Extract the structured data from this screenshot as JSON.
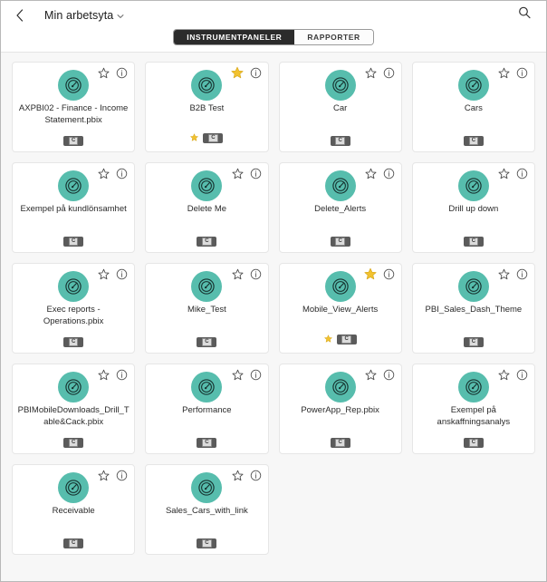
{
  "header": {
    "back_icon": "chevron-left-icon",
    "workspace_title": "Min arbetsyta",
    "dropdown_icon": "chevron-down-icon",
    "search_icon": "search-icon"
  },
  "tabs": [
    {
      "label": "INSTRUMENTPANELER",
      "active": true
    },
    {
      "label": "RAPPORTER",
      "active": false
    }
  ],
  "colors": {
    "accent_teal": "#57bdad",
    "star_gold": "#f2c230",
    "badge_dark": "#5b5b5b",
    "active_tab_bg": "#2b2b2b",
    "content_bg": "#f7f7f7"
  },
  "cards": [
    {
      "title": "AXPBI02 - Finance - Income Statement.pbix",
      "icon": "dashboard-gauge-icon",
      "favorite": false,
      "badge": "C"
    },
    {
      "title": "B2B Test",
      "icon": "dashboard-gauge-icon",
      "favorite": true,
      "badge": "C"
    },
    {
      "title": "Car",
      "icon": "dashboard-gauge-icon",
      "favorite": false,
      "badge": "C"
    },
    {
      "title": "Cars",
      "icon": "dashboard-gauge-icon",
      "favorite": false,
      "badge": "C"
    },
    {
      "title": "Exempel på kundlönsamhet",
      "icon": "dashboard-gauge-icon",
      "favorite": false,
      "badge": "C"
    },
    {
      "title": "Delete Me",
      "icon": "dashboard-gauge-icon",
      "favorite": false,
      "badge": "C"
    },
    {
      "title": "Delete_Alerts",
      "icon": "dashboard-gauge-icon",
      "favorite": false,
      "badge": "C"
    },
    {
      "title": "Drill up down",
      "icon": "dashboard-gauge-icon",
      "favorite": false,
      "badge": "C"
    },
    {
      "title": "Exec reports - Operations.pbix",
      "icon": "dashboard-gauge-icon",
      "favorite": false,
      "badge": "C"
    },
    {
      "title": "Mike_Test",
      "icon": "dashboard-gauge-icon",
      "favorite": false,
      "badge": "C"
    },
    {
      "title": "Mobile_View_Alerts",
      "icon": "dashboard-gauge-icon",
      "favorite": true,
      "badge": "C"
    },
    {
      "title": "PBI_Sales_Dash_Theme",
      "icon": "dashboard-gauge-icon",
      "favorite": false,
      "badge": "C"
    },
    {
      "title": "PBIMobileDownloads_Drill_Table&Cack.pbix",
      "icon": "dashboard-gauge-icon",
      "favorite": false,
      "badge": "C"
    },
    {
      "title": "Performance",
      "icon": "dashboard-gauge-icon",
      "favorite": false,
      "badge": "C"
    },
    {
      "title": "PowerApp_Rep.pbix",
      "icon": "dashboard-gauge-icon",
      "favorite": false,
      "badge": "C"
    },
    {
      "title": "Exempel på anskaffningsanalys",
      "icon": "dashboard-gauge-icon",
      "favorite": false,
      "badge": "C"
    },
    {
      "title": "Receivable",
      "icon": "dashboard-gauge-icon",
      "favorite": false,
      "badge": "C"
    },
    {
      "title": "Sales_Cars_with_link",
      "icon": "dashboard-gauge-icon",
      "favorite": false,
      "badge": "C"
    }
  ]
}
